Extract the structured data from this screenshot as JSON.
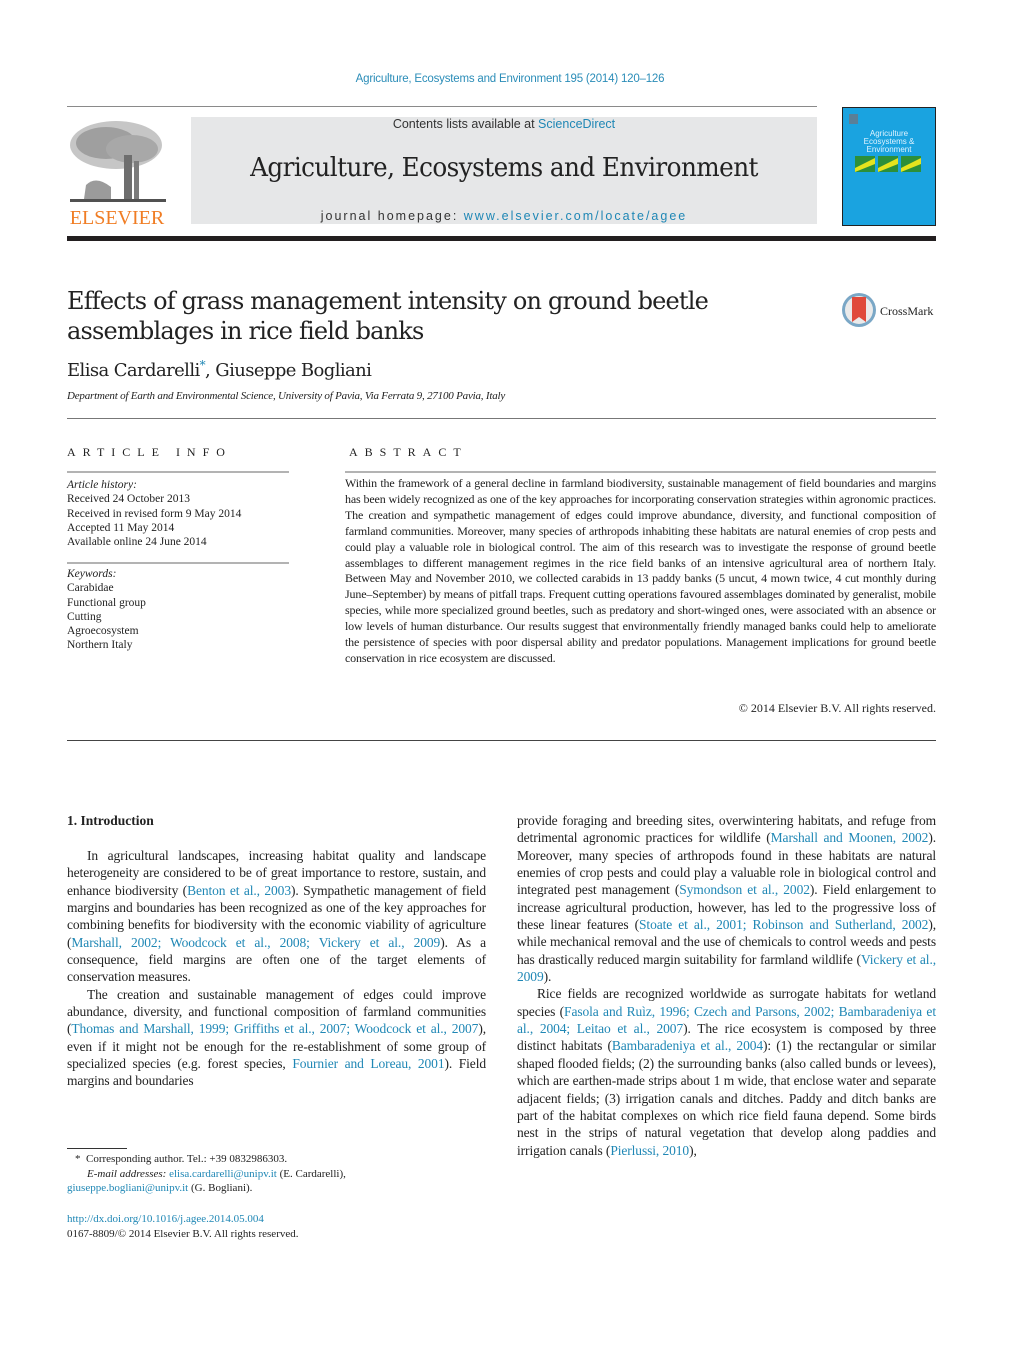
{
  "header": {
    "journal_ref": "Agriculture, Ecosystems and Environment 195 (2014) 120–126",
    "contents_prefix": "Contents lists available at ",
    "contents_link": "ScienceDirect",
    "journal_title": "Agriculture, Ecosystems and Environment",
    "homepage_prefix": "journal homepage: ",
    "homepage_link": "www.elsevier.com/locate/agee",
    "publisher_logo_text": "ELSEVIER",
    "cover_title_lines": [
      "Agriculture",
      "Ecosystems &",
      "Environment"
    ]
  },
  "article": {
    "title": "Effects of grass management intensity on ground beetle assemblages in rice field banks",
    "crossmark_label": "CrossMark",
    "authors": [
      {
        "name": "Elisa Cardarelli",
        "mark": "*"
      },
      {
        "name": "Giuseppe Bogliani",
        "mark": ""
      }
    ],
    "author_separator": ", ",
    "affiliation": "Department of Earth and Environmental Science, University of Pavia, Via Ferrata 9, 27100 Pavia, Italy"
  },
  "article_info": {
    "heading": "ARTICLE INFO",
    "history_label": "Article history:",
    "history": [
      "Received 24 October 2013",
      "Received in revised form 9 May 2014",
      "Accepted 11 May 2014",
      "Available online 24 June 2014"
    ],
    "keywords_label": "Keywords:",
    "keywords": [
      "Carabidae",
      "Functional group",
      "Cutting",
      "Agroecosystem",
      "Northern Italy"
    ]
  },
  "abstract": {
    "heading": "ABSTRACT",
    "text": "Within the framework of a general decline in farmland biodiversity, sustainable management of field boundaries and margins has been widely recognized as one of the key approaches for incorporating conservation strategies within agronomic practices. The creation and sympathetic management of edges could improve abundance, diversity, and functional composition of farmland communities. Moreover, many species of arthropods inhabiting these habitats are natural enemies of crop pests and could play a valuable role in biological control. The aim of this research was to investigate the response of ground beetle assemblages to different management regimes in the rice field banks of an intensive agricultural area of northern Italy. Between May and November 2010, we collected carabids in 13 paddy banks (5 uncut, 4 mown twice, 4 cut monthly during June–September) by means of pitfall traps. Frequent cutting operations favoured assemblages dominated by generalist, mobile species, while more specialized ground beetles, such as predatory and short-winged ones, were associated with an absence or low levels of human disturbance. Our results suggest that environmentally friendly managed banks could help to ameliorate the persistence of species with poor dispersal ability and predator populations. Management implications for ground beetle conservation in rice ecosystem are discussed.",
    "copyright": "© 2014 Elsevier B.V. All rights reserved."
  },
  "body": {
    "section_heading": "1.  Introduction",
    "left_paragraphs": [
      [
        {
          "t": "In agricultural landscapes, increasing habitat quality and landscape heterogeneity are considered to be of great importance to restore, sustain, and enhance biodiversity ("
        },
        {
          "t": "Benton et al., 2003",
          "link": true
        },
        {
          "t": "). Sympathetic management of field margins and boundaries has been recognized as one of the key approaches for combining benefits for biodiversity with the economic viability of agriculture ("
        },
        {
          "t": "Marshall, 2002; Woodcock et al., 2008; Vickery et al., 2009",
          "link": true
        },
        {
          "t": "). As a consequence, field margins are often one of the target elements of conservation measures."
        }
      ],
      [
        {
          "t": "The creation and sustainable management of edges could improve abundance, diversity, and functional composition of farmland communities ("
        },
        {
          "t": "Thomas and Marshall, 1999; Griffiths et al., 2007; Woodcock et al., 2007",
          "link": true
        },
        {
          "t": "), even if it might not be enough for the re-establishment of some group of specialized species (e.g. forest species, "
        },
        {
          "t": "Fournier and Loreau, 2001",
          "link": true
        },
        {
          "t": "). Field margins and boundaries"
        }
      ]
    ],
    "right_paragraphs": [
      [
        {
          "t": "provide foraging and breeding sites, overwintering habitats, and refuge from detrimental agronomic practices for wildlife ("
        },
        {
          "t": "Marshall and Moonen, 2002",
          "link": true
        },
        {
          "t": "). Moreover, many species of arthropods found in these habitats are natural enemies of crop pests and could play a valuable role in biological control and integrated pest management ("
        },
        {
          "t": "Symondson et al., 2002",
          "link": true
        },
        {
          "t": "). Field enlargement to increase agricultural production, however, has led to the progressive loss of these linear features ("
        },
        {
          "t": "Stoate et al., 2001; Robinson and Sutherland, 2002",
          "link": true
        },
        {
          "t": "), while mechanical removal and the use of chemicals to control weeds and pests has drastically reduced margin suitability for farmland wildlife ("
        },
        {
          "t": "Vickery et al., 2009",
          "link": true
        },
        {
          "t": ")."
        }
      ],
      [
        {
          "t": "Rice fields are recognized worldwide as surrogate habitats for wetland species ("
        },
        {
          "t": "Fasola and Ruìz, 1996; Czech and Parsons, 2002; Bambaradeniya et al., 2004; Leitao et al., 2007",
          "link": true
        },
        {
          "t": "). The rice ecosystem is composed by three distinct habitats ("
        },
        {
          "t": "Bambaradeniya et al., 2004",
          "link": true
        },
        {
          "t": "): (1) the rectangular or similar shaped flooded fields; (2) the surrounding banks (also called bunds or levees), which are earthen-made strips about 1 m wide, that enclose water and separate adjacent fields; (3) irrigation canals and ditches. Paddy and ditch banks are part of the habitat complexes on which rice field fauna depend. Some birds nest in the strips of natural vegetation that develop along paddies and irrigation canals ("
        },
        {
          "t": "Pierlussi, 2010",
          "link": true
        },
        {
          "t": "),"
        }
      ]
    ]
  },
  "footnotes": {
    "corresponding_mark": "*",
    "corresponding_text": "Corresponding author. Tel.: +39 0832986303.",
    "email_label": "E-mail addresses:",
    "email_1": "elisa.cardarelli@unipv.it",
    "email_1_owner": " (E. Cardarelli),",
    "email_2": "giuseppe.bogliani@unipv.it",
    "email_2_owner": " (G. Bogliani).",
    "doi": "http://dx.doi.org/10.1016/j.agee.2014.05.004",
    "issn_copyright": "0167-8809/© 2014 Elsevier B.V. All rights reserved."
  }
}
